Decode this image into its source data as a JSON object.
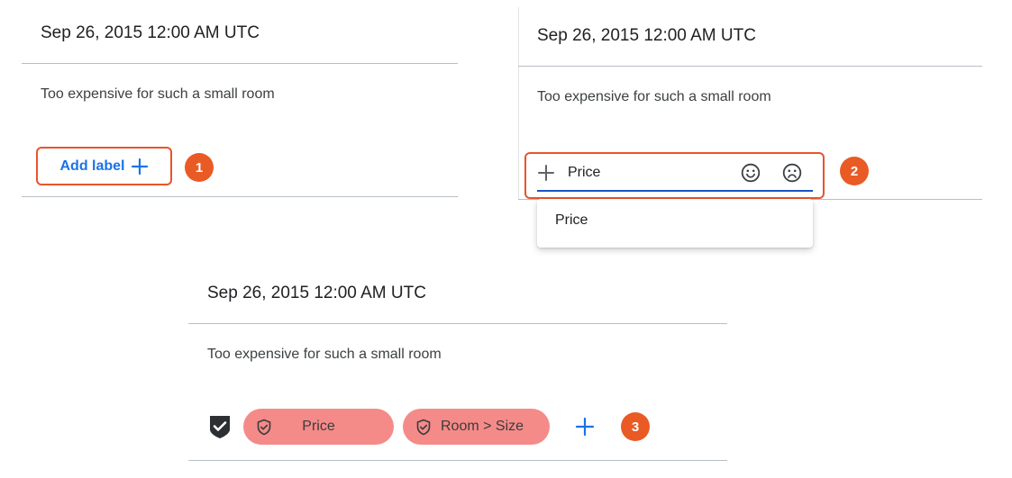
{
  "panel1": {
    "date": "Sep 26, 2015 12:00 AM UTC",
    "review_text": "Too expensive for such a small room",
    "add_label_button": "Add label",
    "step_badge": "1"
  },
  "panel2": {
    "date": "Sep 26, 2015 12:00 AM UTC",
    "review_text": "Too expensive for such a small room",
    "label_input_value": "Price",
    "suggestions": [
      "Price"
    ],
    "step_badge": "2"
  },
  "panel3": {
    "date": "Sep 26, 2015 12:00 AM UTC",
    "review_text": "Too expensive for such a small room",
    "labels": [
      "Price",
      "Room > Size"
    ],
    "step_badge": "3"
  },
  "colors": {
    "accent_blue": "#1a73e8",
    "highlight_orange": "#e8542b",
    "chip_red": "#f48b89"
  },
  "icons": {
    "add": "plus-icon",
    "positive_sentiment": "smiley-icon",
    "negative_sentiment": "frown-icon",
    "confirmed": "shield-check-icon",
    "chip_label": "shield-check-outline-icon"
  }
}
